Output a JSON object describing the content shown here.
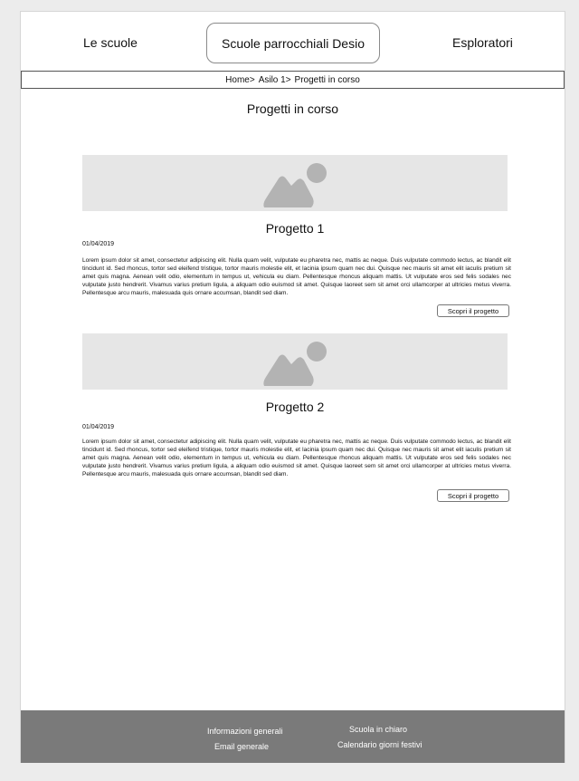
{
  "header": {
    "left_link": "Le scuole",
    "center_title": "Scuole parrocchiali Desio",
    "right_link": "Esploratori"
  },
  "breadcrumb": [
    "Home>",
    "Asilo 1>",
    "Progetti in corso"
  ],
  "main": {
    "title": "Progetti in corso",
    "projects": [
      {
        "title": "Progetto 1",
        "date": "01/04/2019",
        "text": "Lorem ipsum dolor sit amet, consectetur adipiscing elit. Nulla quam velit, vulputate eu pharetra nec, mattis ac neque. Duis vulputate commodo lectus, ac blandit elit tincidunt id. Sed rhoncus, tortor sed eleifend tristique, tortor mauris molestie elit, et lacinia ipsum quam nec dui. Quisque nec mauris sit amet elit iaculis pretium sit amet quis magna. Aenean velit odio, elementum in tempus ut, vehicula eu diam. Pellentesque rhoncus aliquam mattis. Ut vulputate eros sed felis sodales nec vulputate justo hendrerit. Vivamus varius pretium ligula, a aliquam odio euismod sit amet. Quisque laoreet sem sit amet orci ullamcorper at ultricies metus viverra. Pellentesque arcu mauris, malesuada quis ornare accumsan, blandit sed diam.",
        "button": "Scopri il progetto",
        "image_icon": "image-placeholder-icon"
      },
      {
        "title": "Progetto 2",
        "date": "01/04/2019",
        "text": "Lorem ipsum dolor sit amet, consectetur adipiscing elit. Nulla quam velit, vulputate eu pharetra nec, mattis ac neque. Duis vulputate commodo lectus, ac blandit elit tincidunt id. Sed rhoncus, tortor sed eleifend tristique, tortor mauris molestie elit, et lacinia ipsum quam nec dui. Quisque nec mauris sit amet elit iaculis pretium sit amet quis magna. Aenean velit odio, elementum in tempus ut, vehicula eu diam. Pellentesque rhoncus aliquam mattis. Ut vulputate eros sed felis sodales nec vulputate justo hendrerit. Vivamus varius pretium ligula, a aliquam odio euismod sit amet. Quisque laoreet sem sit amet orci ullamcorper at ultricies metus viverra. Pellentesque arcu mauris, malesuada quis ornare accumsan, blandit sed diam.",
        "button": "Scopri il progetto",
        "image_icon": "image-placeholder-icon"
      }
    ]
  },
  "footer": {
    "links": [
      "Informazioni generali",
      "Email generale",
      "Scuola in chiaro",
      "Calendario giorni festivi"
    ]
  },
  "colors": {
    "page_background": "#ececec",
    "footer_background": "#7a7a7a",
    "image_placeholder": "#e6e6e6",
    "image_icon": "#b3b3b3"
  }
}
